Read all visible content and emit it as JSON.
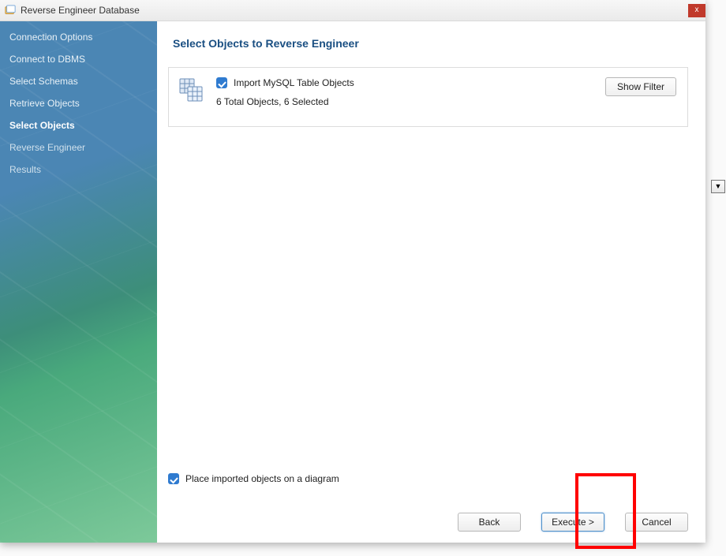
{
  "window": {
    "title": "Reverse Engineer Database",
    "close_glyph": "x"
  },
  "sidebar": {
    "items": [
      {
        "label": "Connection Options",
        "active": false
      },
      {
        "label": "Connect to DBMS",
        "active": false
      },
      {
        "label": "Select Schemas",
        "active": false
      },
      {
        "label": "Retrieve Objects",
        "active": false
      },
      {
        "label": "Select Objects",
        "active": true
      },
      {
        "label": "Reverse Engineer",
        "active": false,
        "dim": true
      },
      {
        "label": "Results",
        "active": false,
        "dim": true
      }
    ]
  },
  "main": {
    "page_title": "Select Objects to Reverse Engineer",
    "panel": {
      "checkbox_label": "Import MySQL Table Objects",
      "subtext": "6 Total Objects, 6 Selected",
      "show_filter_label": "Show Filter"
    },
    "place_label": "Place imported objects on a diagram",
    "buttons": {
      "back": "Back",
      "execute": "Execute >",
      "cancel": "Cancel"
    }
  },
  "bg": {
    "dropdown_glyph": "▼"
  }
}
